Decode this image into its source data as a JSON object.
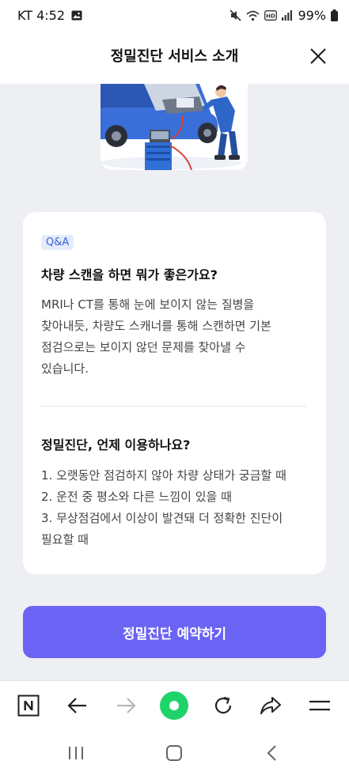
{
  "status": {
    "carrier_time": "KT 4:52",
    "battery": "99%"
  },
  "header": {
    "title": "정밀진단 서비스 소개"
  },
  "card": {
    "badge": "Q&A",
    "q1": "차량 스캔을 하면 뭐가 좋은가요?",
    "a1_lines": [
      "MRI나 CT를 통해 눈에 보이지 않는 질병을",
      "찾아내듯, 차량도 스캐너를 통해 스캔하면 기본",
      "점검으로는 보이지 않던 문제를 찾아낼 수",
      "있습니다."
    ],
    "q2": "정밀진단, 언제 이용하나요?",
    "a2_lines": [
      "1. 오랫동안 점검하지 않아 차량 상태가 궁금할 때",
      "2. 운전 중 평소와 다른 느낌이 있을 때",
      "3. 무상점검에서 이상이 발견돼 더 정확한 진단이",
      "필요할 때"
    ]
  },
  "cta": {
    "label": "정밀진단 예약하기"
  },
  "colors": {
    "accent": "#6b63f3",
    "badge_text": "#3b64d8",
    "green": "#1fd36b"
  },
  "icons": {
    "browser_bar": [
      "naver-n-icon",
      "back-arrow-icon",
      "forward-arrow-icon",
      "green-dot-icon",
      "refresh-icon",
      "share-icon",
      "menu-icon"
    ],
    "system_nav": [
      "recent-apps-icon",
      "home-icon",
      "back-icon"
    ]
  }
}
